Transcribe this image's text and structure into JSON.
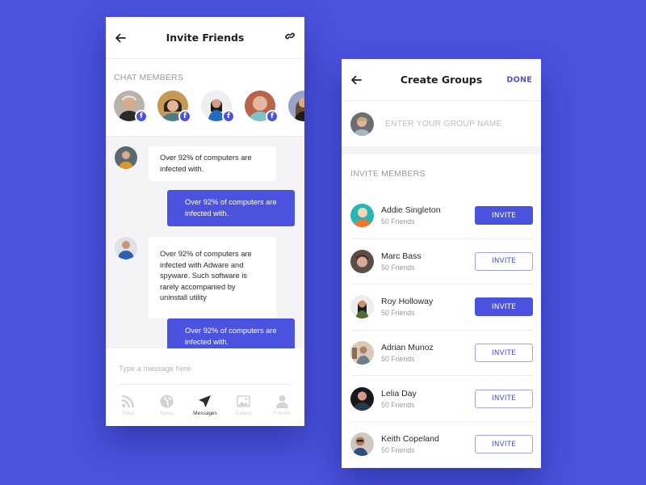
{
  "colors": {
    "background": "#4b52de",
    "accent": "#4b52de",
    "chat_bg": "#f4f4f6"
  },
  "invite_friends": {
    "title": "Invite Friends",
    "back_icon": "arrow-left-icon",
    "link_icon": "link-icon",
    "chat_members_label": "CHAT MEMBERS",
    "members": [
      {
        "avatar": "older-man-avatar",
        "badge": "f"
      },
      {
        "avatar": "woman-bangs-avatar",
        "badge": "f"
      },
      {
        "avatar": "woman-blue-dress-avatar",
        "badge": "f"
      },
      {
        "avatar": "bald-man-avatar",
        "badge": "f"
      },
      {
        "avatar": "woman-long-hair-avatar",
        "badge": "f"
      }
    ],
    "messages": [
      {
        "direction": "in",
        "text": "Over 92% of computers are infected with."
      },
      {
        "direction": "out",
        "text": "Over 92% of computers are infected with."
      },
      {
        "direction": "in",
        "text": "Over 92% of computers are infected with Adware and spyware. Such software is rarely accompanied by uninstall utility"
      },
      {
        "direction": "out",
        "text": "Over 92% of computers are infected with."
      }
    ],
    "compose_placeholder": "Type a message here",
    "tabs": [
      {
        "label": "Feed",
        "icon": "rss-icon",
        "active": false
      },
      {
        "label": "News",
        "icon": "globe-icon",
        "active": false
      },
      {
        "label": "Messages",
        "icon": "paper-plane-icon",
        "active": true
      },
      {
        "label": "Gallery",
        "icon": "image-icon",
        "active": false
      },
      {
        "label": "Friends",
        "icon": "person-icon",
        "active": false
      }
    ]
  },
  "create_groups": {
    "title": "Create Groups",
    "done_label": "DONE",
    "group_name_placeholder": "ENTER YOUR GROUP NAME",
    "invite_members_label": "INVITE MEMBERS",
    "members": [
      {
        "name": "Addie Singleton",
        "friends": "50 Friends",
        "button": "INVITE",
        "invited": true
      },
      {
        "name": "Marc Bass",
        "friends": "50 Friends",
        "button": "INVITE",
        "invited": false
      },
      {
        "name": "Roy Holloway",
        "friends": "50 Friends",
        "button": "INVITE",
        "invited": true
      },
      {
        "name": "Adrian Munoz",
        "friends": "50 Friends",
        "button": "INVITE",
        "invited": false
      },
      {
        "name": "Lelia Day",
        "friends": "50 Friends",
        "button": "INVITE",
        "invited": false
      },
      {
        "name": "Keith Copeland",
        "friends": "50 Friends",
        "button": "INVITE",
        "invited": false
      }
    ]
  }
}
